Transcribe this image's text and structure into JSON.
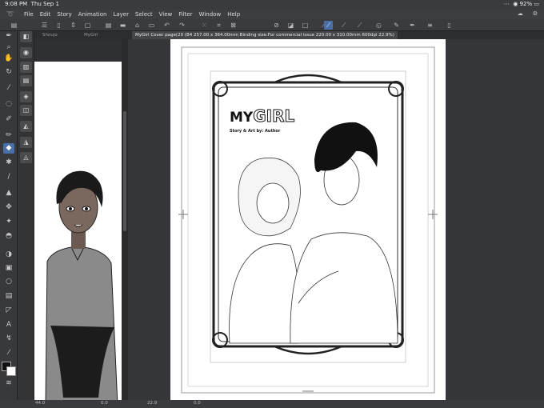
{
  "status": {
    "time": "9:08 PM",
    "date": "Thu Sep 1",
    "battery": "92%"
  },
  "menu": [
    "File",
    "Edit",
    "Story",
    "Animation",
    "Layer",
    "Select",
    "View",
    "Filter",
    "Window",
    "Help"
  ],
  "tabs": {
    "left_1": "Shoujo",
    "left_2": "MyGirl",
    "active": "MyGirl Cover page(20 (B4 257.00 x 364.00mm Binding size:For commercial issue 220.00 x 310.00mm 600dpi 22.9%)"
  },
  "cover": {
    "title_my": "MY",
    "title_girl": "GIRL",
    "byline": "Story & Art by: Author"
  },
  "bottom": {
    "zoom_left": "44.0",
    "angle_left": "0.0",
    "zoom_right": "22.9",
    "angle_right": "0.0"
  },
  "colors": {
    "accent": "#4a6ea6",
    "main_color": "#111111",
    "sub_color": "#ffffff"
  }
}
